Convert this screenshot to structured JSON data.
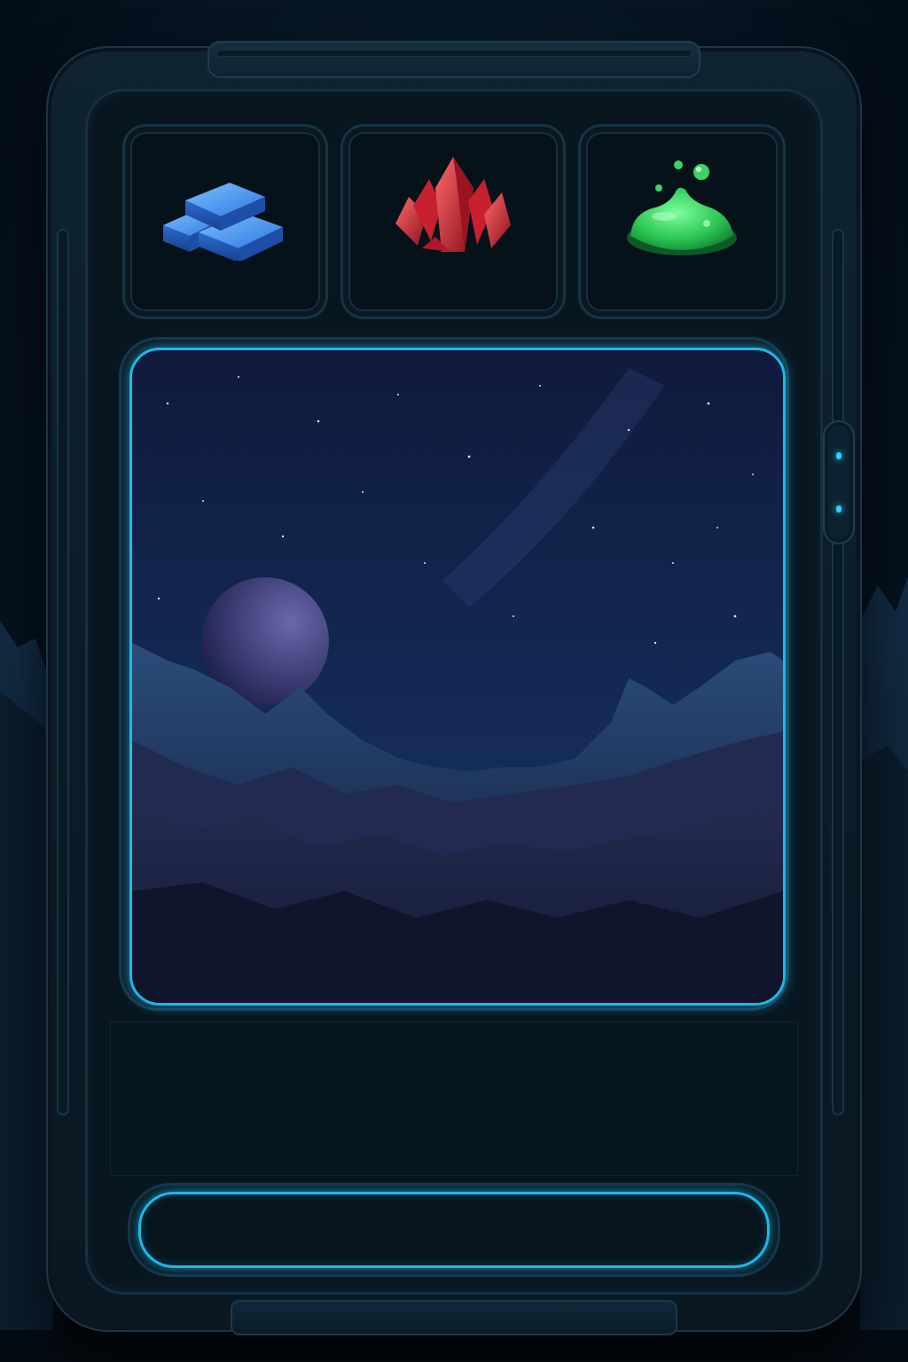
{
  "theme": {
    "accent": "#1fb8e8",
    "frame": "#0b1c28",
    "background": "#061422"
  },
  "resources": [
    {
      "name": "metal",
      "icon": "metal-ingots-icon",
      "color": "#2f7fe6"
    },
    {
      "name": "crystal",
      "icon": "red-crystal-icon",
      "color": "#d8283a"
    },
    {
      "name": "gas",
      "icon": "green-slime-icon",
      "color": "#2ccf5a"
    }
  ],
  "scene": {
    "icon": "alien-planet-landscape",
    "planet_color": "#3a3a72",
    "sky_color": "#0d1c44"
  },
  "info_panel": {
    "text": ""
  },
  "action_bar": {
    "label": ""
  }
}
